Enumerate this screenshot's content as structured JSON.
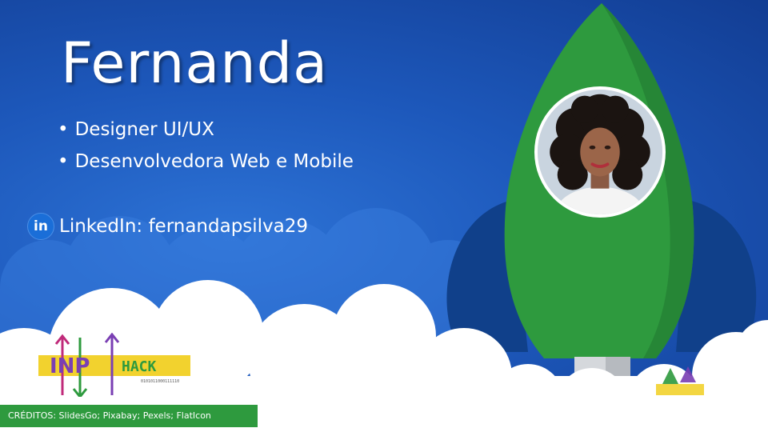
{
  "slide": {
    "name": "Fernanda",
    "roles": [
      "Designer UI/UX",
      "Desenvolvedora Web e Mobile"
    ],
    "bullet_glyph": "•",
    "linkedin": {
      "icon": "linkedin-icon",
      "icon_text": "in",
      "label": "LinkedIn: fernandapsilva29"
    },
    "credits": "CRÉDITOS: SlidesGo; Pixabay; Pexels; FlatIcon",
    "logo": {
      "icon": "inphack-logo",
      "text": "INPHack"
    },
    "colors": {
      "background": "#1d58bb",
      "rocket_green": "#2e9a3e",
      "rocket_dark": "#0f3f86",
      "cloud": "#ffffff",
      "credits_bar": "#2e9a3e"
    }
  }
}
